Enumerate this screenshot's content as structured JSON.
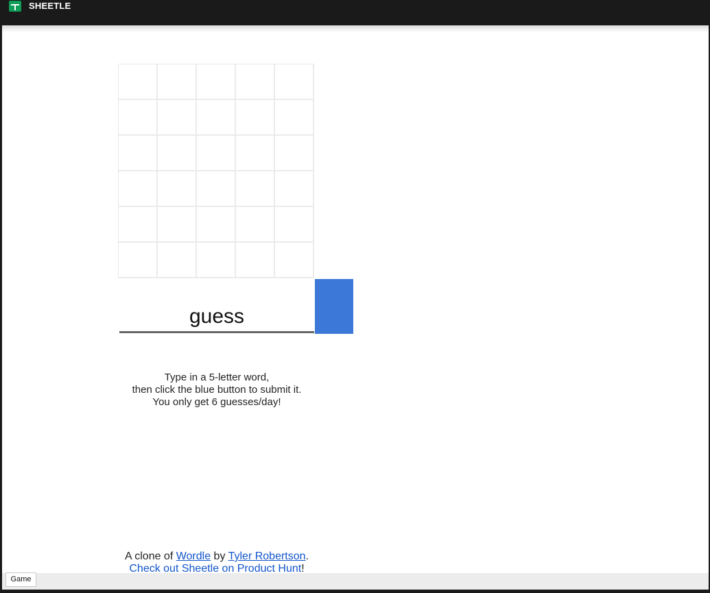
{
  "app": {
    "title": "SHEETLE",
    "logo_icon": "sheets-logo-icon"
  },
  "grid": {
    "rows": 6,
    "cols": 5
  },
  "input": {
    "placeholder": "guess",
    "value": ""
  },
  "submit": {
    "color": "#3c78d8"
  },
  "instructions": {
    "line1": "Type in a 5-letter word,",
    "line2": "then click the blue button to submit it.",
    "line3": "You only get 6 guesses/day!"
  },
  "credits": {
    "prefix": "A clone of ",
    "wordle_link": "Wordle",
    "by": " by ",
    "author_link": "Tyler Robertson",
    "period": ".",
    "producthunt_link": "Check out Sheetle on Product Hunt",
    "exclaim": "!"
  },
  "tabs": [
    {
      "label": "Game"
    }
  ]
}
